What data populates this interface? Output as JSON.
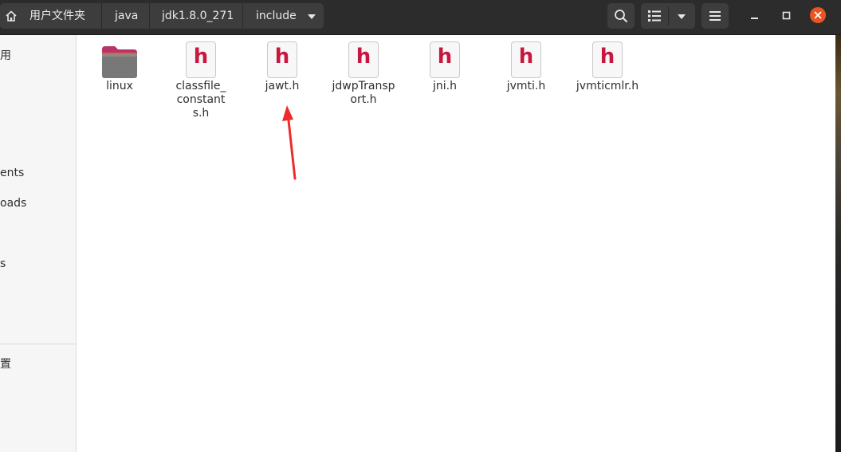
{
  "breadcrumb": {
    "items": [
      {
        "label": "用户文件夹"
      },
      {
        "label": "java"
      },
      {
        "label": "jdk1.8.0_271"
      },
      {
        "label": "include"
      }
    ]
  },
  "toolbar": {
    "search_icon": "search-icon",
    "list_view_icon": "list-view-icon",
    "view_options_icon": "chevron-down-icon",
    "menu_icon": "hamburger-menu-icon"
  },
  "window": {
    "minimize_icon": "minimize-icon",
    "maximize_icon": "maximize-icon",
    "close_icon": "close-icon",
    "close_color": "#e95420"
  },
  "sidebar": {
    "items": [
      {
        "label": "用"
      },
      {
        "label": "ents"
      },
      {
        "label": "oads"
      },
      {
        "label": "s"
      },
      {
        "label": "置"
      }
    ]
  },
  "files": [
    {
      "name": "linux",
      "type": "folder"
    },
    {
      "name": "classfile_constants.h",
      "type": "header"
    },
    {
      "name": "jawt.h",
      "type": "header"
    },
    {
      "name": "jdwpTransport.h",
      "type": "header"
    },
    {
      "name": "jni.h",
      "type": "header"
    },
    {
      "name": "jvmti.h",
      "type": "header"
    },
    {
      "name": "jvmticmlr.h",
      "type": "header"
    }
  ],
  "header_icon_glyph": "h",
  "colors": {
    "header_glyph": "#c7163f",
    "annotation_arrow": "#ee2b2b"
  }
}
